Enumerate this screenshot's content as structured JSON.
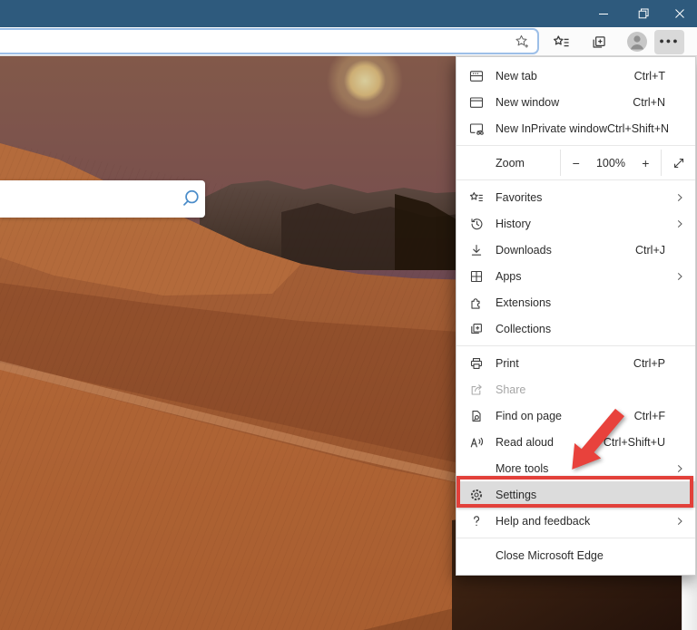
{
  "window": {
    "controls": [
      {
        "name": "minimize",
        "icon": "minimize-icon"
      },
      {
        "name": "restore",
        "icon": "restore-icon"
      },
      {
        "name": "close",
        "icon": "close-icon"
      }
    ],
    "title_bar_color": "#2e5a7d"
  },
  "toolbar": {
    "address_bar": {
      "value": "",
      "favorite_icon": "star-add-icon"
    },
    "icons": [
      "favorites-list-icon",
      "collections-icon",
      "profile-avatar",
      "more-ellipsis-icon"
    ],
    "more_glyph": "●●●",
    "more_button_active": true
  },
  "page": {
    "search_box": {
      "value": "",
      "icon": "search-magnifier-icon",
      "icon_color": "#4a8cc9"
    },
    "wallpaper": "desert-dunes-sunset"
  },
  "menu": {
    "zoom_row": {
      "label": "Zoom",
      "minus": "−",
      "level": "100%",
      "plus": "+",
      "fullscreen_icon": "fullscreen-icon"
    },
    "items": [
      {
        "label": "New tab",
        "shortcut": "Ctrl+T",
        "icon": "new-tab-icon"
      },
      {
        "label": "New window",
        "shortcut": "Ctrl+N",
        "icon": "new-window-icon"
      },
      {
        "label": "New InPrivate window",
        "shortcut": "Ctrl+Shift+N",
        "icon": "inprivate-icon"
      },
      {
        "label": "Favorites",
        "submenu": true,
        "icon": "favorites-icon"
      },
      {
        "label": "History",
        "submenu": true,
        "icon": "history-icon"
      },
      {
        "label": "Downloads",
        "shortcut": "Ctrl+J",
        "icon": "downloads-icon"
      },
      {
        "label": "Apps",
        "submenu": true,
        "icon": "apps-icon"
      },
      {
        "label": "Extensions",
        "icon": "extensions-icon"
      },
      {
        "label": "Collections",
        "icon": "collections-icon"
      },
      {
        "label": "Print",
        "shortcut": "Ctrl+P",
        "icon": "print-icon"
      },
      {
        "label": "Share",
        "disabled": true,
        "icon": "share-icon"
      },
      {
        "label": "Find on page",
        "shortcut": "Ctrl+F",
        "icon": "find-on-page-icon"
      },
      {
        "label": "Read aloud",
        "shortcut": "Ctrl+Shift+U",
        "icon": "read-aloud-icon"
      },
      {
        "label": "More tools",
        "submenu": true
      },
      {
        "label": "Settings",
        "icon": "settings-gear-icon",
        "highlighted": true
      },
      {
        "label": "Help and feedback",
        "submenu": true,
        "icon": "help-icon"
      },
      {
        "label": "Close Microsoft Edge"
      }
    ]
  },
  "annotation": {
    "shape": "red box around Settings with red arrow pointing at it",
    "color": "#e2403a"
  },
  "colors": {
    "titlebar": "#2e5a7d",
    "accent_red": "#e2403a",
    "address_border": "#9dbfe8",
    "menu_highlight": "#dcdcdc",
    "sky": "#7d564c",
    "sand": "#a25e34",
    "sun": "#d6c795"
  }
}
